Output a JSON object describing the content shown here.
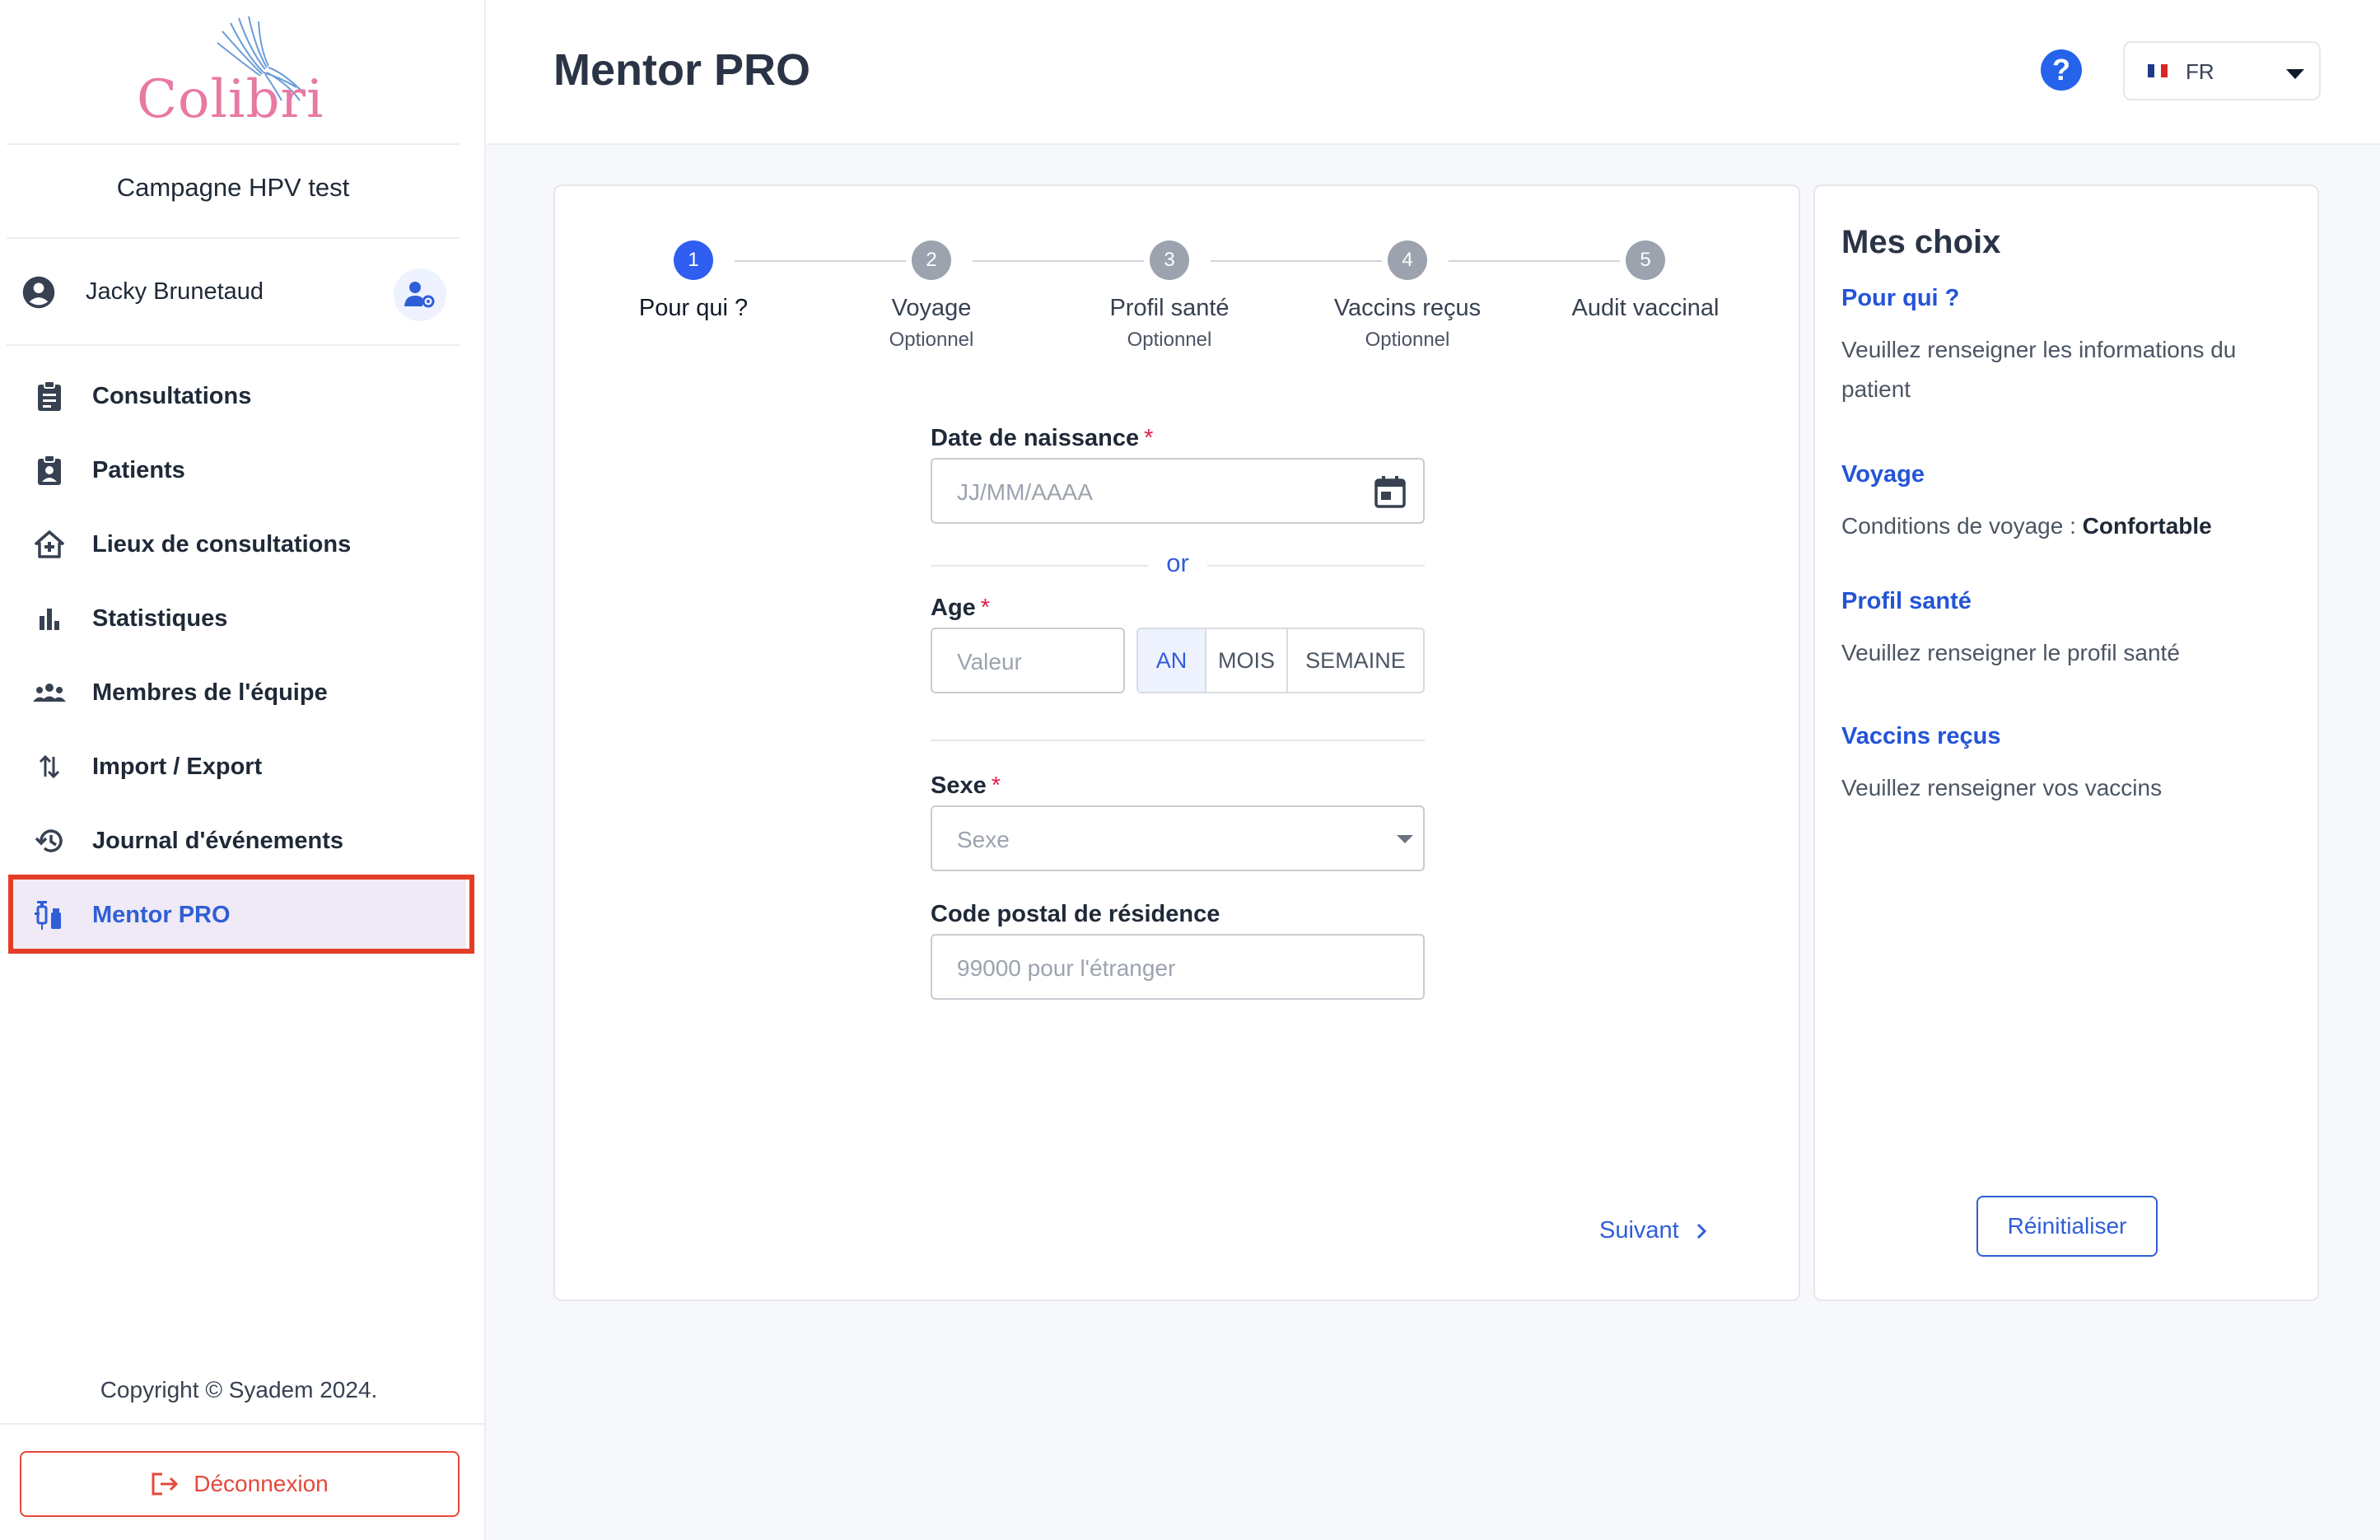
{
  "app": {
    "logo_text": "Colibri",
    "campaign": "Campagne HPV test",
    "user_name": "Jacky Brunetaud",
    "copyright": "Copyright © Syadem 2024.",
    "logout_label": "Déconnexion"
  },
  "sidebar": {
    "items": [
      {
        "label": "Consultations",
        "icon": "clipboard-icon"
      },
      {
        "label": "Patients",
        "icon": "patient-badge-icon"
      },
      {
        "label": "Lieux de consultations",
        "icon": "home-plus-icon"
      },
      {
        "label": "Statistiques",
        "icon": "bar-chart-icon"
      },
      {
        "label": "Membres de l'équipe",
        "icon": "team-icon"
      },
      {
        "label": "Import / Export",
        "icon": "import-export-icon"
      },
      {
        "label": "Journal d'événements",
        "icon": "history-icon"
      },
      {
        "label": "Mentor PRO",
        "icon": "vaccine-icon",
        "active": true
      }
    ]
  },
  "header": {
    "title": "Mentor PRO",
    "help_icon": "?",
    "language": "FR"
  },
  "stepper": {
    "steps": [
      {
        "number": "1",
        "label": "Pour qui ?",
        "sub": "",
        "active": true
      },
      {
        "number": "2",
        "label": "Voyage",
        "sub": "Optionnel"
      },
      {
        "number": "3",
        "label": "Profil santé",
        "sub": "Optionnel"
      },
      {
        "number": "4",
        "label": "Vaccins reçus",
        "sub": "Optionnel"
      },
      {
        "number": "5",
        "label": "Audit vaccinal",
        "sub": ""
      }
    ]
  },
  "form": {
    "birthdate_label": "Date de naissance",
    "birthdate_placeholder": "JJ/MM/AAAA",
    "or_label": "or",
    "age_label": "Age",
    "age_placeholder": "Valeur",
    "units": [
      "AN",
      "MOIS",
      "SEMAINE"
    ],
    "selected_unit": "AN",
    "sex_label": "Sexe",
    "sex_placeholder": "Sexe",
    "postal_label": "Code postal de résidence",
    "postal_placeholder": "99000 pour l'étranger",
    "required_mark": "*",
    "next_label": "Suivant"
  },
  "choices": {
    "title": "Mes choix",
    "sections": [
      {
        "head": "Pour qui ?",
        "text": "Veuillez renseigner les informations du patient"
      },
      {
        "head": "Voyage",
        "text": "Conditions de voyage : ",
        "value": "Confortable"
      },
      {
        "head": "Profil santé",
        "text": "Veuillez renseigner le profil santé"
      },
      {
        "head": "Vaccins reçus",
        "text": "Veuillez renseigner vos vaccins"
      }
    ],
    "reset_label": "Réinitialiser"
  },
  "colors": {
    "accent": "#2f5ed8",
    "active_step": "#2f5ef0",
    "danger": "#e5483c",
    "highlight_box": "#e53c26",
    "logo_pink": "#e879a4"
  }
}
